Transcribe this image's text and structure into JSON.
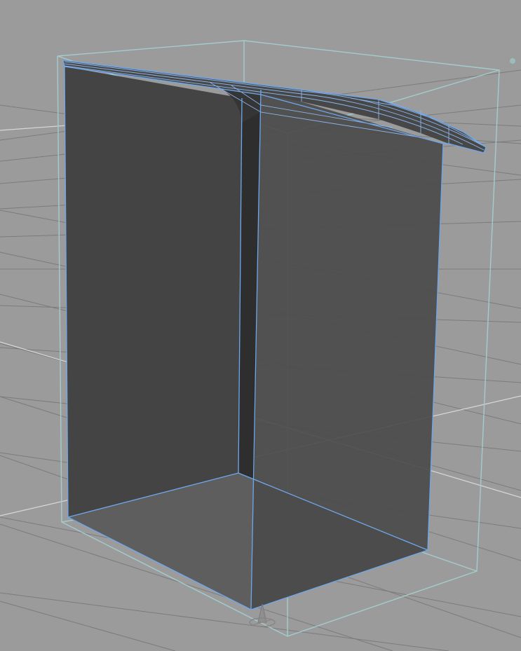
{
  "viewport": {
    "kind": "3d-perspective-viewport",
    "background_color": "#9b9b9b",
    "grid_color": "#7a7a7a",
    "grid_axis_color": "#dcdcdc",
    "selection_color": "#6ea8ec",
    "bounding_box_color": "#9cc7c7",
    "face_dark_color": "#3e3e3e",
    "face_mid_color": "#474747",
    "face_light_color": "#5a5a5a"
  },
  "scene": {
    "object": "cabinet-mesh",
    "selected": true,
    "pivot_icon": "pivot-manipulator-icon"
  }
}
